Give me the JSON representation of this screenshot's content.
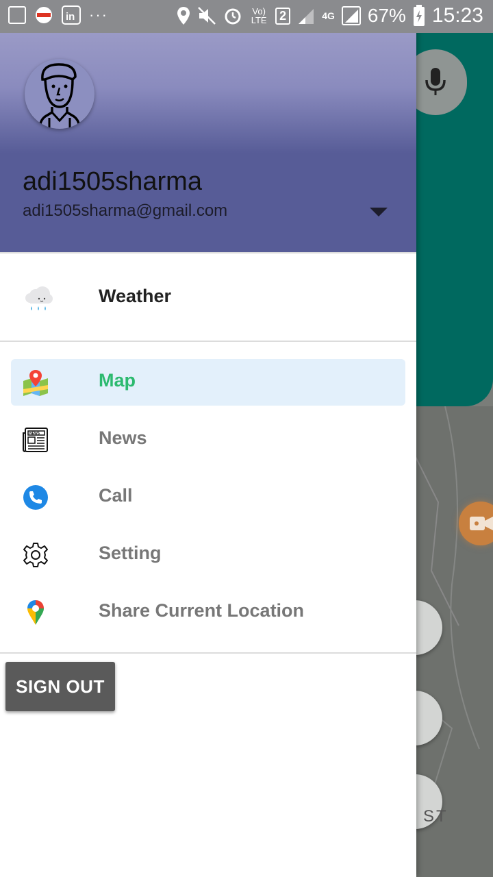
{
  "status_bar": {
    "network": "4G",
    "volte": "Vo) LTE",
    "sim": "2",
    "battery": "67%",
    "time": "15:23"
  },
  "account": {
    "name": "adi1505sharma",
    "email": "adi1505sharma@gmail.com"
  },
  "menu": {
    "weather": "Weather",
    "map": "Map",
    "news": "News",
    "call": "Call",
    "setting": "Setting",
    "share_location": "Share Current Location",
    "selected": "Map"
  },
  "sign_out": "SIGN OUT",
  "background": {
    "map_text": "ST"
  },
  "colors": {
    "header": "#575c97",
    "selected_bg": "#e3f0fb",
    "selected_text": "#2cba6f",
    "button": "#5a5a5a"
  }
}
